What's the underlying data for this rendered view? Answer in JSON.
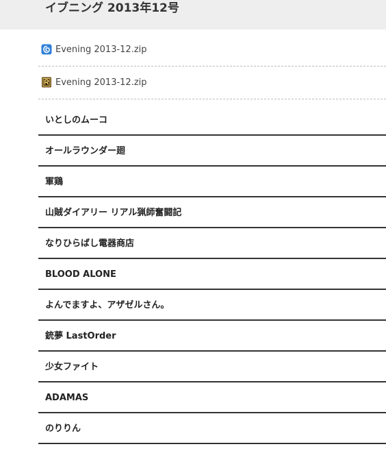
{
  "header": {
    "title": "イブニング 2013年12号"
  },
  "downloads": [
    {
      "icon": "cloud-download-icon",
      "filename": "Evening 2013-12.zip"
    },
    {
      "icon": "rar-archive-icon",
      "filename": "Evening 2013-12.zip"
    }
  ],
  "chapters": [
    "いとしのムーコ",
    "オールラウンダー廻",
    "軍鶏",
    "山賊ダイアリー リアル猟師奮闘記",
    "なりひらばし電器商店",
    "BLOOD ALONE",
    "よんでますよ、アザゼルさん。",
    "銃夢 LastOrder",
    "少女ファイト",
    "ADAMAS",
    "のりりん"
  ],
  "colors": {
    "header_bg": "#eeeeee",
    "cloud_icon": "#2f80d8",
    "rar_icon": "#6b4a1e"
  }
}
